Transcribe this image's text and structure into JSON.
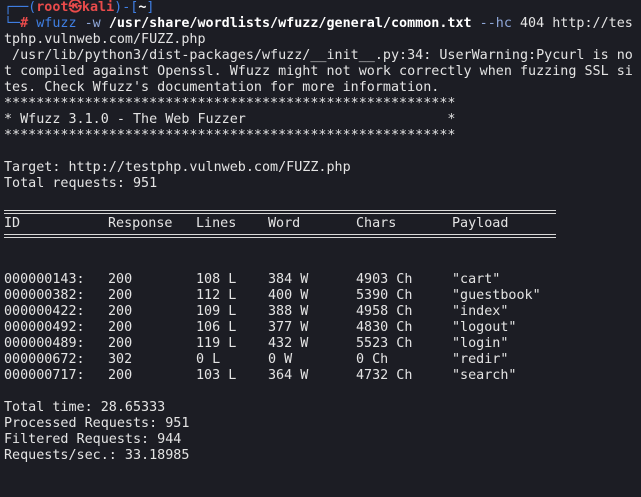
{
  "prompt": {
    "user": "root",
    "skull": "㉿",
    "host": "kali",
    "dir": "~",
    "symbol": "#"
  },
  "command": {
    "program": "wfuzz",
    "flag_w": "-w",
    "wordlist": "/usr/share/wordlists/wfuzz/general/common.txt",
    "flag_hc": "--hc",
    "hc_value": "404",
    "url_part1": "http://tes",
    "url_part2": "tphp.vulnweb.com/FUZZ.php"
  },
  "warning": {
    "line1": " /usr/lib/python3/dist-packages/wfuzz/__init__.py:34: UserWarning:Pycurl is no",
    "line2": "t compiled against Openssl. Wfuzz might not work correctly when fuzzing SSL si",
    "line3": "tes. Check Wfuzz's documentation for more information."
  },
  "banner": {
    "stars": "********************************************************",
    "title_line": "* Wfuzz 3.1.0 - The Web Fuzzer                         *"
  },
  "target_line": "Target: http://testphp.vulnweb.com/FUZZ.php",
  "total_requests_line": "Total requests: 951",
  "table": {
    "headers": [
      "ID",
      "Response",
      "Lines",
      "Word",
      "Chars",
      "Payload"
    ],
    "rows": [
      [
        "000000143:",
        "200",
        "108 L",
        "384 W",
        "4903 Ch",
        "\"cart\""
      ],
      [
        "000000382:",
        "200",
        "112 L",
        "400 W",
        "5390 Ch",
        "\"guestbook\""
      ],
      [
        "000000422:",
        "200",
        "109 L",
        "388 W",
        "4958 Ch",
        "\"index\""
      ],
      [
        "000000492:",
        "200",
        "106 L",
        "377 W",
        "4830 Ch",
        "\"logout\""
      ],
      [
        "000000489:",
        "200",
        "119 L",
        "432 W",
        "5523 Ch",
        "\"login\""
      ],
      [
        "000000672:",
        "302",
        "0 L",
        "0 W",
        "0 Ch",
        "\"redir\""
      ],
      [
        "000000717:",
        "200",
        "103 L",
        "364 W",
        "4732 Ch",
        "\"search\""
      ]
    ]
  },
  "summary": {
    "total_time": "Total time: 28.65333",
    "processed": "Processed Requests: 951",
    "filtered": "Filtered Requests: 944",
    "rate": "Requests/sec.: 33.18985"
  },
  "colors": {
    "background": "#1c1d24",
    "prompt_frame": "#3f7fe4",
    "prompt_user": "#e94b4b",
    "flag": "#8fa7d8"
  }
}
